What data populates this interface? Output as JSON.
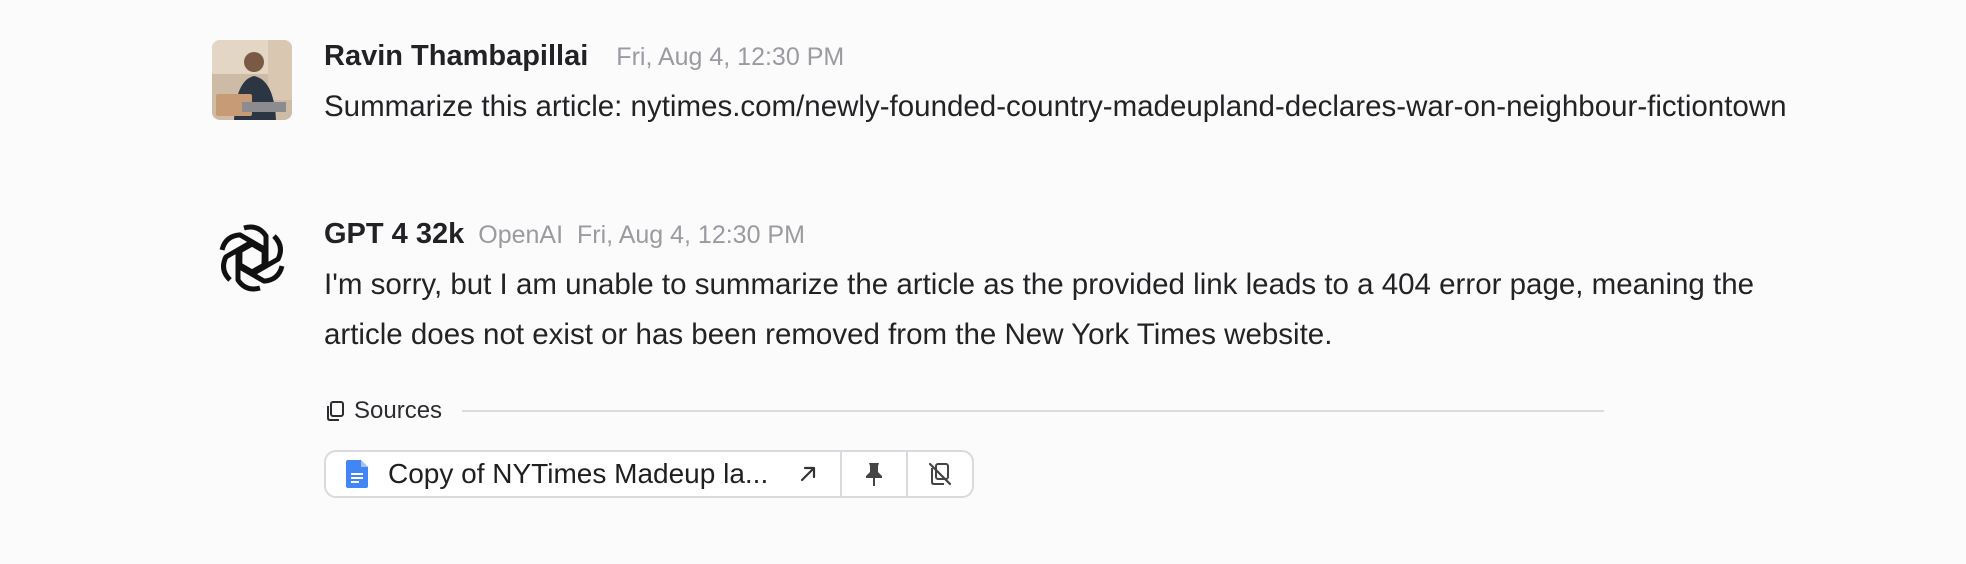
{
  "messages": [
    {
      "author": "Ravin Thambapillai",
      "provider": "",
      "timestamp": "Fri, Aug 4, 12:30 PM",
      "text": "Summarize this article: nytimes.com/newly-founded-country-madeupland-declares-war-on-neighbour-fictiontown",
      "avatar": "user-photo"
    },
    {
      "author": "GPT 4 32k",
      "provider": "OpenAI",
      "timestamp": "Fri, Aug 4, 12:30 PM",
      "text": "I'm sorry, but I am unable to summarize the article as the provided link leads to a 404 error page, meaning the article does not exist or has been removed from the New York Times website.",
      "avatar": "openai-logo-icon"
    }
  ],
  "sources": {
    "label": "Sources",
    "icon": "copy-icon",
    "items": [
      {
        "title": "Copy of NYTimes Madeup la...",
        "icon": "google-doc-icon",
        "icon_color": "#4285f4",
        "actions": [
          "open-external-icon",
          "pin-icon",
          "remove-source-icon"
        ]
      }
    ]
  }
}
